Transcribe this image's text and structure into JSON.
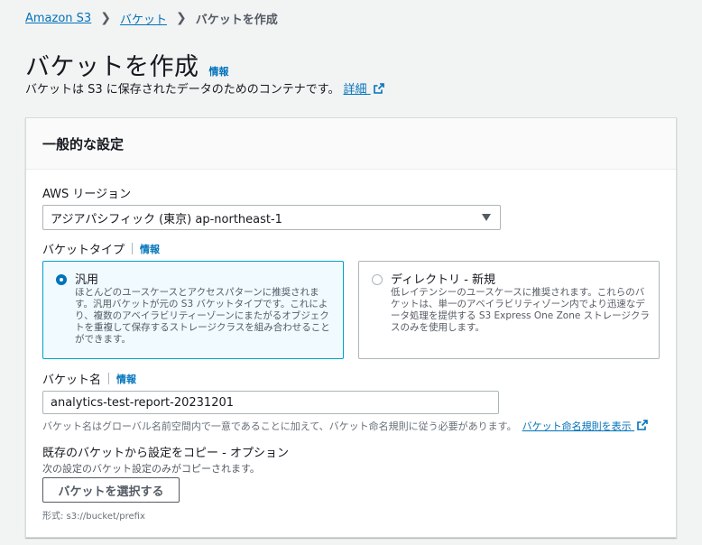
{
  "breadcrumb": {
    "items": [
      "Amazon S3",
      "バケット"
    ],
    "current": "バケットを作成"
  },
  "page": {
    "title": "バケットを作成",
    "info": "情報",
    "subtitle": "バケットは S3 に保存されたデータのためのコンテナです。",
    "detail_link": "詳細"
  },
  "panel": {
    "title": "一般的な設定",
    "region": {
      "label": "AWS リージョン",
      "value": "アジアパシフィック (東京) ap-northeast-1"
    },
    "bucket_type": {
      "label": "バケットタイプ",
      "info": "情報",
      "options": [
        {
          "title": "汎用",
          "selected": true,
          "description": "ほとんどのユースケースとアクセスパターンに推奨されます。汎用バケットが元の S3 バケットタイプです。これにより、複数のアベイラビリティーゾーンにまたがるオブジェクトを重複して保存するストレージクラスを組み合わせることができます。"
        },
        {
          "title": "ディレクトリ - 新規",
          "selected": false,
          "description": "低レイテンシーのユースケースに推奨されます。これらのバケットは、単一のアベイラビリティゾーン内でより迅速なデータ処理を提供する S3 Express One Zone ストレージクラスのみを使用します。"
        }
      ]
    },
    "bucket_name": {
      "label": "バケット名",
      "info": "情報",
      "value": "analytics-test-report-20231201",
      "hint": "バケット名はグローバル名前空間内で一意であることに加えて、バケット命名規則に従う必要があります。",
      "rules_link": "バケット命名規則を表示"
    },
    "copy_settings": {
      "title": "既存のバケットから設定をコピー - オプション",
      "subtitle": "次の設定のバケット設定のみがコピーされます。",
      "button": "バケットを選択する",
      "format": "形式: s3://bucket/prefix"
    }
  },
  "colors": {
    "link": "#0073bb",
    "selected_border": "#00a1c9",
    "selected_bg": "#f1faff"
  }
}
